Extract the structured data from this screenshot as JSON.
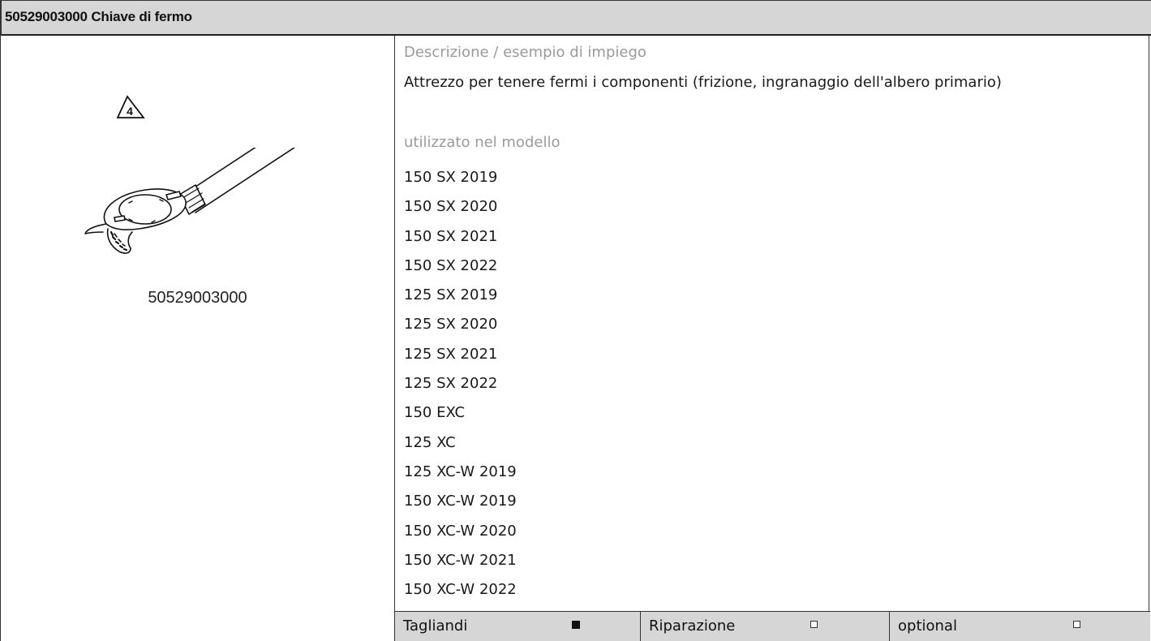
{
  "header": {
    "title": "50529003000 Chiave di fermo"
  },
  "image_panel": {
    "part_number": "50529003000",
    "warning_number": "4"
  },
  "info": {
    "description_label": "Descrizione / esempio di impiego",
    "description": "Attrezzo per tenere fermi i componenti (frizione, ingranaggio dell'albero primario)",
    "models_label": "utilizzato nel modello",
    "models": [
      "150 SX 2019",
      "150 SX 2020",
      "150 SX 2021",
      "150 SX 2022",
      "125 SX 2019",
      "125 SX 2020",
      "125 SX 2021",
      "125 SX 2022",
      "150 EXC",
      "125 XC",
      "125 XC-W 2019",
      "150 XC-W 2019",
      "150 XC-W 2020",
      "150 XC-W 2021",
      "150 XC-W 2022"
    ]
  },
  "footer": {
    "items": [
      {
        "label": "Tagliandi",
        "checked": true
      },
      {
        "label": "Riparazione",
        "checked": false
      },
      {
        "label": "optional",
        "checked": false
      }
    ]
  }
}
